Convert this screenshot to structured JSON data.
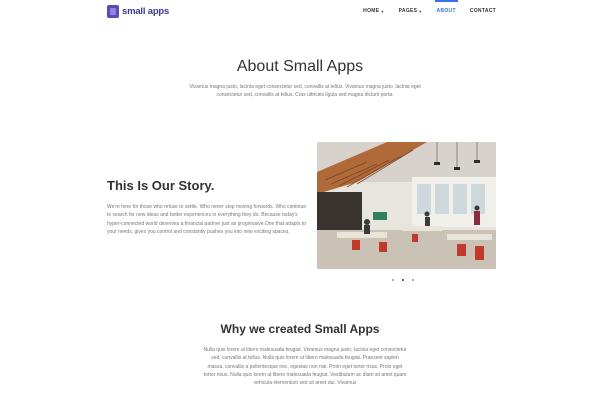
{
  "brand": {
    "name": "small apps",
    "color": "#3c3a8f"
  },
  "nav": {
    "items": [
      {
        "label": "HOME",
        "dropdown": true,
        "active": false
      },
      {
        "label": "PAGES",
        "dropdown": true,
        "active": false
      },
      {
        "label": "ABOUT",
        "dropdown": false,
        "active": true
      },
      {
        "label": "CONTACT",
        "dropdown": false,
        "active": false
      }
    ],
    "active_color": "#3b6ef0"
  },
  "about": {
    "title": "About Small Apps",
    "text": "Vivamus magna justo, lacinia eget consectetur sed, convallis at tellus. Vivamus magna justo, lacinia eget consectetur sed, convallis at tellus. Cras ultricies ligula sed magna dictum porta."
  },
  "story": {
    "title": "This Is Our Story.",
    "text": "We're here for those who refuse to settle. Who never stop moving forwards. Who continue to search for new ideas and better experiences in everything they do. Because today's hyper-connected world deserves a financial partner just as progressive.One that adapts to your needs, gives you control and constantly pushes you into new exciting spaces."
  },
  "carousel": {
    "slides": 3,
    "active_index": 1
  },
  "why": {
    "title": "Why we created Small Apps",
    "text": "Nulla quis lorem ut libero malesuada feugiat. Vivamus magna justo, lacinia eget consectetur sed, convallis at tellus. Nulla quis lorem ut libero malesuada feugiat. Praesent sapien massa, convallis a pellentesque nec, egestas non nisi. Proin eget tortor risus. Proin eget tortor risus. Nulla quis lorem ut libero malesuada feugiat. Vestibulum ac diam sit amet quam vehicula elementum sed sit amet dui. Vivamus"
  }
}
